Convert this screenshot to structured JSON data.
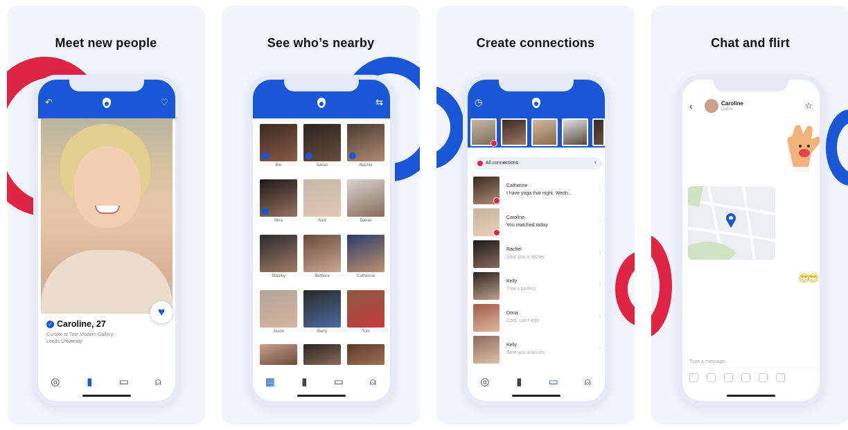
{
  "colors": {
    "brand_blue": "#1a57d6",
    "accent_red": "#e02444",
    "panel_bg": "#f3f5fb"
  },
  "panels": [
    {
      "title": "Meet new people",
      "profile": {
        "name": "Caroline, 27",
        "line1": "Curator at Tate Modern Gallery",
        "line2": "Leeds University"
      }
    },
    {
      "title": "See who’s nearby",
      "nearby": [
        {
          "name": "Bin"
        },
        {
          "name": "Sarah"
        },
        {
          "name": "Rachel"
        },
        {
          "name": "Mira"
        },
        {
          "name": "Alex"
        },
        {
          "name": "Daniel"
        },
        {
          "name": "Stanley"
        },
        {
          "name": "Barbara"
        },
        {
          "name": "Catherine"
        },
        {
          "name": "Jason"
        },
        {
          "name": "Barry"
        },
        {
          "name": "Tom"
        },
        {
          "name": ""
        },
        {
          "name": ""
        },
        {
          "name": ""
        }
      ]
    },
    {
      "title": "Create connections",
      "filter_label": "All connections",
      "connections": [
        {
          "name": "Catherine",
          "message": "I have yoga that night. Wedn..."
        },
        {
          "name": "Caroline",
          "message": "You matched today"
        },
        {
          "name": "Rachel",
          "message": "Sent you a kisses"
        },
        {
          "name": "Kelly",
          "message": "That's perfect"
        },
        {
          "name": "Dona",
          "message": "Cool, can't wait"
        },
        {
          "name": "Kelly",
          "message": "Sent you a kisses"
        }
      ]
    },
    {
      "title": "Chat and flirt",
      "chat": {
        "contact_name": "Caroline",
        "status": "Online",
        "emoji_message": "😎😎",
        "input_placeholder": "Type a message..."
      }
    }
  ],
  "icons": {
    "back": "↶",
    "heart_outline": "♡",
    "heart": "♥",
    "filter": "⇆",
    "history": "◷",
    "globe": "◎",
    "cards": "▮",
    "chat": "▭",
    "profile": "⍝",
    "grid": "▦",
    "chevron_left": "‹",
    "star": "☆",
    "chevron_right": "›",
    "check": "✓"
  }
}
